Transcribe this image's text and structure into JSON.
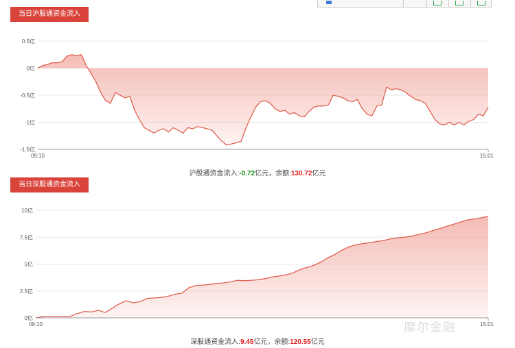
{
  "panel1": {
    "header": "当日沪股通资金流入",
    "caption_label": "沪股通资金流入:",
    "flow_value": "-0.72",
    "unit1": "亿元，余额:",
    "balance_value": "130.72",
    "unit2": "亿元"
  },
  "panel2": {
    "header": "当日深股通资金流入",
    "caption_label": "深股通资金流入:",
    "flow_value": "9.45",
    "unit1": "亿元，余额:",
    "balance_value": "120.55",
    "unit2": "亿元"
  },
  "watermark": "摩尔金融",
  "colors": {
    "line": "#e06050",
    "fill": "#f3b0a8",
    "header": "#d9433a",
    "negative": "#1a8a1a",
    "positive": "#e02020"
  },
  "chart_data": [
    {
      "type": "area",
      "x_start": "09:10",
      "x_end": "15:01",
      "ylim": [
        -1.5,
        0.5
      ],
      "yticks": [
        "0.5亿",
        "0亿",
        "-0.5亿",
        "-1亿",
        "-1.5亿"
      ],
      "values": [
        0,
        0.05,
        0.07,
        0.1,
        0.1,
        0.12,
        0.22,
        0.25,
        0.23,
        0.25,
        0.05,
        -0.1,
        -0.25,
        -0.45,
        -0.6,
        -0.65,
        -0.45,
        -0.5,
        -0.55,
        -0.52,
        -0.78,
        -0.95,
        -1.1,
        -1.15,
        -1.2,
        -1.15,
        -1.12,
        -1.18,
        -1.1,
        -1.15,
        -1.2,
        -1.1,
        -1.12,
        -1.08,
        -1.1,
        -1.12,
        -1.15,
        -1.25,
        -1.35,
        -1.42,
        -1.4,
        -1.38,
        -1.35,
        -1.1,
        -0.9,
        -0.72,
        -0.62,
        -0.6,
        -0.65,
        -0.75,
        -0.8,
        -0.78,
        -0.85,
        -0.82,
        -0.88,
        -0.9,
        -0.8,
        -0.72,
        -0.7,
        -0.7,
        -0.68,
        -0.5,
        -0.52,
        -0.55,
        -0.6,
        -0.62,
        -0.58,
        -0.75,
        -0.85,
        -0.88,
        -0.7,
        -0.68,
        -0.35,
        -0.4,
        -0.38,
        -0.4,
        -0.45,
        -0.52,
        -0.58,
        -0.6,
        -0.65,
        -0.8,
        -0.95,
        -1.03,
        -1.05,
        -1.0,
        -1.05,
        -1.0,
        -1.05,
        -0.98,
        -0.95,
        -0.85,
        -0.88,
        -0.72
      ]
    },
    {
      "type": "area",
      "x_start": "09:10",
      "x_end": "15:01",
      "ylim": [
        0,
        10
      ],
      "yticks": [
        "10亿",
        "7.5亿",
        "5亿",
        "2.5亿",
        "0亿"
      ],
      "values": [
        0,
        0.1,
        0.1,
        0.1,
        0.12,
        0.15,
        0.4,
        0.6,
        0.55,
        0.7,
        0.5,
        0.9,
        1.3,
        1.6,
        1.4,
        1.5,
        1.8,
        1.85,
        1.9,
        2.0,
        2.2,
        2.3,
        2.8,
        3.0,
        3.05,
        3.1,
        3.2,
        3.25,
        3.35,
        3.5,
        3.45,
        3.5,
        3.55,
        3.65,
        3.8,
        3.9,
        4.0,
        4.2,
        4.5,
        4.7,
        4.9,
        5.2,
        5.6,
        5.9,
        6.3,
        6.6,
        6.8,
        6.9,
        7.0,
        7.1,
        7.2,
        7.35,
        7.45,
        7.5,
        7.6,
        7.75,
        7.9,
        8.1,
        8.3,
        8.5,
        8.7,
        8.9,
        9.1,
        9.2,
        9.3,
        9.45
      ]
    }
  ]
}
